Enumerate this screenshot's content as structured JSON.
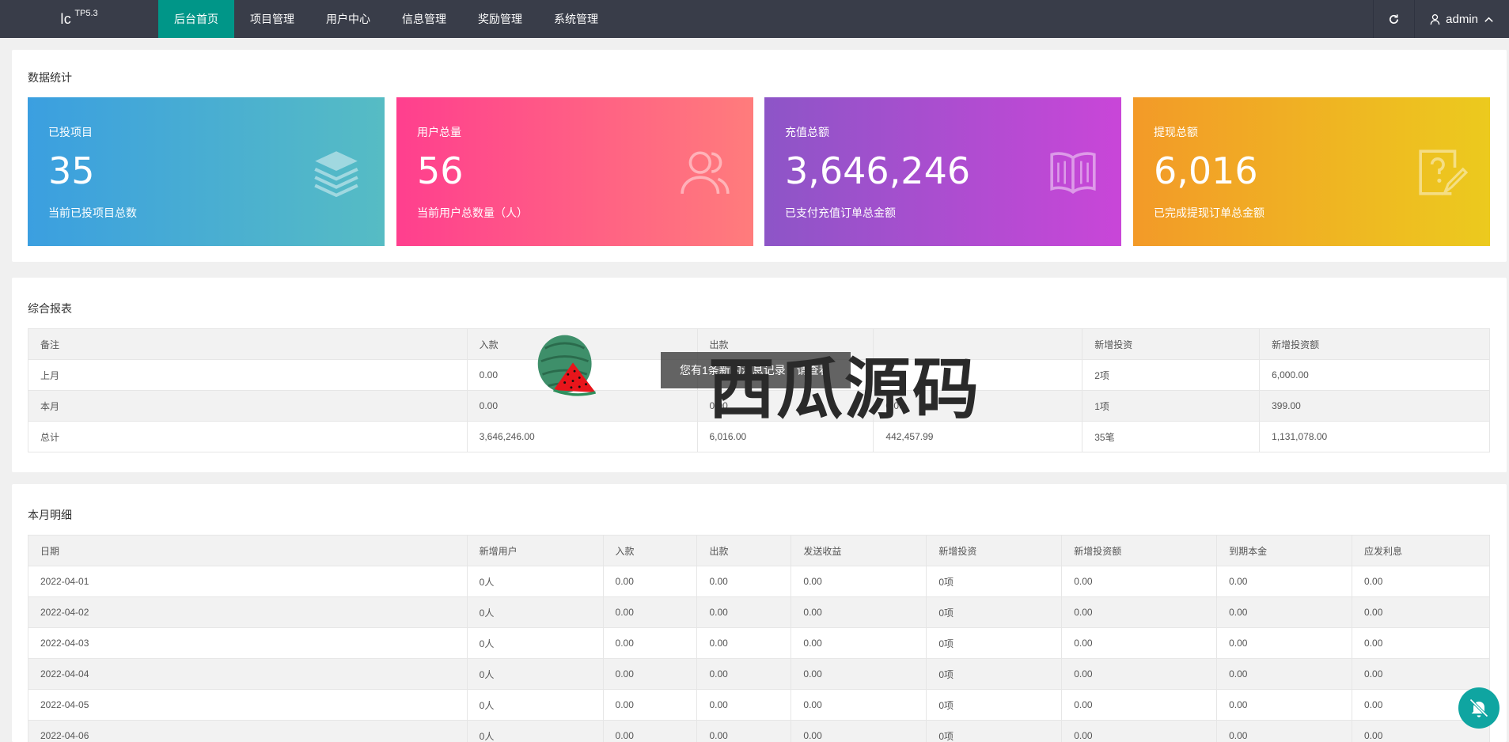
{
  "app": {
    "logo_text": "lc",
    "logo_version": "TP5.3"
  },
  "nav": {
    "items": [
      {
        "label": "后台首页",
        "active": true
      },
      {
        "label": "项目管理",
        "active": false
      },
      {
        "label": "用户中心",
        "active": false
      },
      {
        "label": "信息管理",
        "active": false
      },
      {
        "label": "奖励管理",
        "active": false
      },
      {
        "label": "系统管理",
        "active": false
      }
    ]
  },
  "topbar": {
    "refresh_icon": "refresh-icon",
    "user_icon": "user-icon",
    "username": "admin"
  },
  "stats": {
    "title": "数据统计",
    "tiles": [
      {
        "label": "已投项目",
        "value": "35",
        "sub": "当前已投项目总数",
        "icon": "layers-icon",
        "colors": [
          "#3b9fe0",
          "#56bcc4"
        ]
      },
      {
        "label": "用户总量",
        "value": "56",
        "sub": "当前用户总数量（人）",
        "icon": "users-icon",
        "colors": [
          "#ff3f8e",
          "#ff7c7c"
        ]
      },
      {
        "label": "充值总额",
        "value": "3,646,246",
        "sub": "已支付充值订单总金额",
        "icon": "book-icon",
        "colors": [
          "#8d55c7",
          "#c946d8"
        ]
      },
      {
        "label": "提现总额",
        "value": "6,016",
        "sub": "已完成提现订单总金额",
        "icon": "question-edit-icon",
        "colors": [
          "#f39a28",
          "#ecca1e"
        ]
      }
    ]
  },
  "report": {
    "title": "综合报表",
    "headers": [
      "备注",
      "入款",
      "出款",
      "",
      "新增投资",
      "新增投资额"
    ],
    "rows": [
      [
        "上月",
        "0.00",
        "",
        "",
        "2项",
        "6,000.00"
      ],
      [
        "本月",
        "0.00",
        "0.00",
        "0.00",
        "1项",
        "399.00"
      ],
      [
        "总计",
        "3,646,246.00",
        "6,016.00",
        "442,457.99",
        "35笔",
        "1,131,078.00"
      ]
    ]
  },
  "monthly": {
    "title": "本月明细",
    "headers": [
      "日期",
      "新增用户",
      "入款",
      "出款",
      "发送收益",
      "新增投资",
      "新增投资额",
      "到期本金",
      "应发利息"
    ],
    "rows": [
      [
        "2022-04-01",
        "0人",
        "0.00",
        "0.00",
        "0.00",
        "0项",
        "0.00",
        "0.00",
        "0.00"
      ],
      [
        "2022-04-02",
        "0人",
        "0.00",
        "0.00",
        "0.00",
        "0项",
        "0.00",
        "0.00",
        "0.00"
      ],
      [
        "2022-04-03",
        "0人",
        "0.00",
        "0.00",
        "0.00",
        "0项",
        "0.00",
        "0.00",
        "0.00"
      ],
      [
        "2022-04-04",
        "0人",
        "0.00",
        "0.00",
        "0.00",
        "0项",
        "0.00",
        "0.00",
        "0.00"
      ],
      [
        "2022-04-05",
        "0人",
        "0.00",
        "0.00",
        "0.00",
        "0项",
        "0.00",
        "0.00",
        "0.00"
      ],
      [
        "2022-04-06",
        "0人",
        "0.00",
        "0.00",
        "0.00",
        "0项",
        "0.00",
        "0.00",
        "0.00"
      ]
    ]
  },
  "watermark": {
    "toast": "您有1条新的消息记录，请查看",
    "brand": "西瓜源码"
  },
  "float_button": {
    "icon": "bell-off-icon",
    "color": "#0fa5a1"
  }
}
